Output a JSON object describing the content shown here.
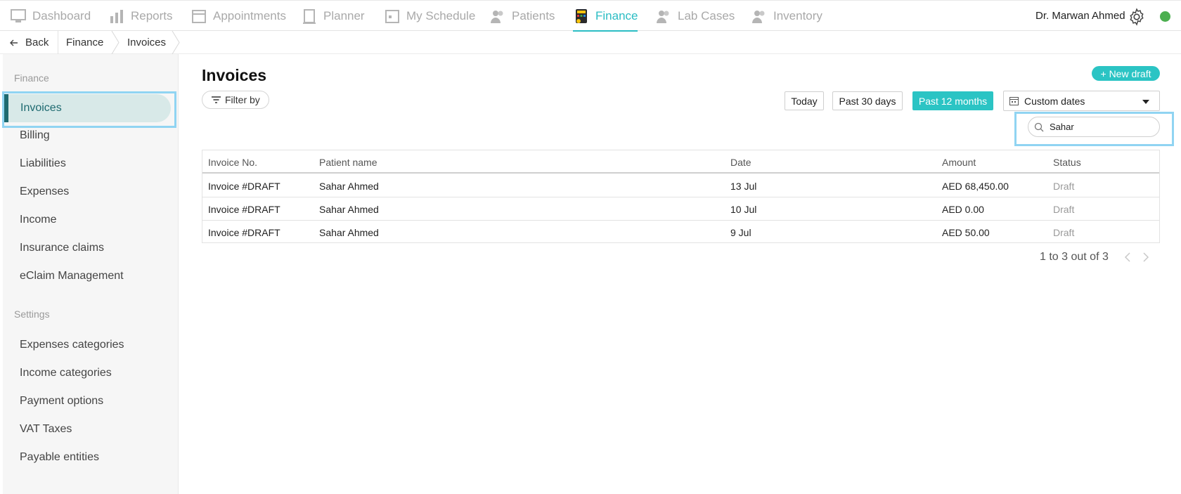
{
  "topnav": {
    "items": [
      {
        "label": "Dashboard",
        "icon": "dashboard-icon"
      },
      {
        "label": "Reports",
        "icon": "reports-icon"
      },
      {
        "label": "Appointments",
        "icon": "appointments-icon"
      },
      {
        "label": "Planner",
        "icon": "planner-icon"
      },
      {
        "label": "My Schedule",
        "icon": "schedule-icon"
      },
      {
        "label": "Patients",
        "icon": "patients-icon"
      },
      {
        "label": "Finance",
        "icon": "finance-icon"
      },
      {
        "label": "Lab Cases",
        "icon": "lab-cases-icon"
      },
      {
        "label": "Inventory",
        "icon": "inventory-icon"
      }
    ],
    "active": "Finance",
    "user_name": "Dr. Marwan Ahmed",
    "accent": "#2bbdc4",
    "status_color": "#4caf50"
  },
  "breadcrumb": {
    "back": "Back",
    "items": [
      "Finance",
      "Invoices"
    ]
  },
  "sidebar": {
    "section_finance": "Finance",
    "finance_items": [
      "Invoices",
      "Billing",
      "Liabilities",
      "Expenses",
      "Income",
      "Insurance claims",
      "eClaim Management"
    ],
    "section_settings": "Settings",
    "settings_items": [
      "Expenses categories",
      "Income categories",
      "Payment options",
      "VAT Taxes",
      "Payable entities"
    ],
    "active": "Invoices"
  },
  "main": {
    "title": "Invoices",
    "filter_label": "Filter by",
    "new_draft_label": "+ New draft",
    "ranges": [
      "Today",
      "Past 30 days",
      "Past 12 months"
    ],
    "active_range": "Past 12 months",
    "custom_dates_label": "Custom dates",
    "search": {
      "value": "Sahar",
      "placeholder": ""
    }
  },
  "table": {
    "columns": [
      "Invoice No.",
      "Patient name",
      "Date",
      "Amount",
      "Status"
    ],
    "rows": [
      [
        "Invoice #DRAFT",
        "Sahar Ahmed",
        "13 Jul",
        "AED 68,450.00",
        "Draft"
      ],
      [
        "Invoice #DRAFT",
        "Sahar Ahmed",
        "10 Jul",
        "AED 0.00",
        "Draft"
      ],
      [
        "Invoice #DRAFT",
        "Sahar Ahmed",
        "9 Jul",
        "AED 50.00",
        "Draft"
      ]
    ]
  },
  "pagination": {
    "text": "1 to 3 out of 3"
  }
}
